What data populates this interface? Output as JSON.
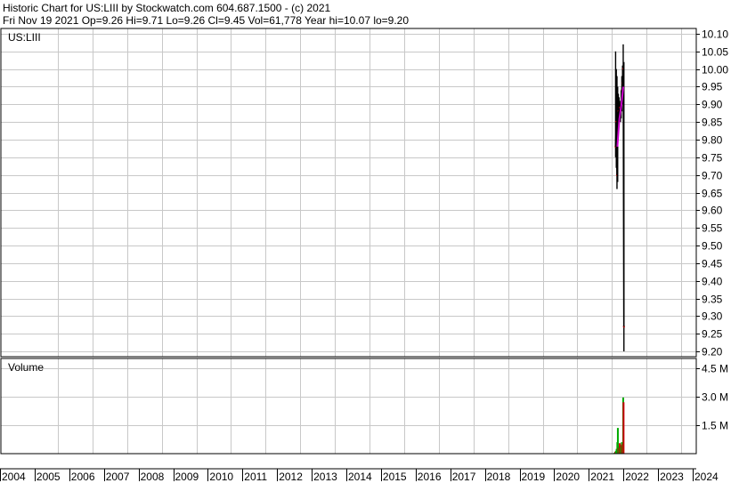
{
  "header": {
    "line1": "Historic Chart for US:LIII by Stockwatch.com 604.687.1500 - (c) 2021",
    "line2": "Fri Nov 19 2021  Op=9.26  Hi=9.71  Lo=9.26  Cl=9.45  Vol=61,778  Year hi=10.07  lo=9.20"
  },
  "price_panel": {
    "symbol_label": "US:LIII"
  },
  "volume_panel": {
    "label": "Volume"
  },
  "colors": {
    "price_line": "#000000",
    "moving_average": "#cc00cc",
    "vol_up": "#00aa00",
    "vol_down": "#cc0000",
    "grid": "#c8c8c8"
  },
  "chart_data": [
    {
      "type": "line",
      "title": "US:LIII",
      "x_axis_labels": [
        "2004",
        "2005",
        "2006",
        "2007",
        "2008",
        "2009",
        "2010",
        "2011",
        "2012",
        "2013",
        "2014",
        "2015",
        "2016",
        "2017",
        "2018",
        "2019",
        "2020",
        "2021",
        "2022",
        "2023",
        "2024"
      ],
      "y_tick_labels": [
        "10.10",
        "10.05",
        "10.00",
        "9.95",
        "9.90",
        "9.85",
        "9.80",
        "9.75",
        "9.70",
        "9.65",
        "9.60",
        "9.55",
        "9.50",
        "9.45",
        "9.40",
        "9.35",
        "9.30",
        "9.25",
        "9.20"
      ],
      "ylim": [
        9.185,
        10.115
      ],
      "grid": true,
      "series": [
        {
          "values": [
            {
              "t": 2021.08,
              "hi": 10.05,
              "lo": 9.75,
              "cl": 9.78
            },
            {
              "t": 2021.1,
              "hi": 10.0,
              "lo": 9.72,
              "cl": 9.85
            },
            {
              "t": 2021.12,
              "hi": 9.98,
              "lo": 9.66,
              "cl": 9.7
            },
            {
              "t": 2021.14,
              "hi": 9.95,
              "lo": 9.68,
              "cl": 9.8
            },
            {
              "t": 2021.16,
              "hi": 9.93,
              "lo": 9.82,
              "cl": 9.88
            },
            {
              "t": 2021.18,
              "hi": 9.92,
              "lo": 9.84,
              "cl": 9.86
            },
            {
              "t": 2021.2,
              "hi": 9.91,
              "lo": 9.86,
              "cl": 9.89
            },
            {
              "t": 2021.22,
              "hi": 9.9,
              "lo": 9.85,
              "cl": 9.87
            },
            {
              "t": 2021.24,
              "hi": 9.94,
              "lo": 9.86,
              "cl": 9.9
            },
            {
              "t": 2021.26,
              "hi": 9.98,
              "lo": 9.88,
              "cl": 9.94
            },
            {
              "t": 2021.28,
              "hi": 10.01,
              "lo": 9.9,
              "cl": 9.96
            },
            {
              "t": 2021.3,
              "hi": 10.07,
              "lo": 9.92,
              "cl": 10.0
            },
            {
              "t": 2021.32,
              "hi": 10.02,
              "lo": 9.2,
              "cl": 9.27
            }
          ]
        },
        {
          "values": [
            {
              "t": 2021.13,
              "v": 9.78
            },
            {
              "t": 2021.16,
              "v": 9.82
            },
            {
              "t": 2021.19,
              "v": 9.86
            },
            {
              "t": 2021.22,
              "v": 9.88
            },
            {
              "t": 2021.25,
              "v": 9.9
            },
            {
              "t": 2021.28,
              "v": 9.93
            },
            {
              "t": 2021.3,
              "v": 9.95
            }
          ]
        }
      ]
    },
    {
      "type": "bar",
      "title": "Volume",
      "y_tick_labels": [
        "4.5 M",
        "3.0 M",
        "1.5 M"
      ],
      "ylim": [
        0,
        5.0
      ],
      "units": "M",
      "series": [
        {
          "values": [
            {
              "t": 2021.05,
              "v": 0.05,
              "up": true
            },
            {
              "t": 2021.07,
              "v": 0.1,
              "up": false
            },
            {
              "t": 2021.09,
              "v": 0.15,
              "up": true
            },
            {
              "t": 2021.11,
              "v": 0.25,
              "up": true
            },
            {
              "t": 2021.13,
              "v": 0.6,
              "up": true
            },
            {
              "t": 2021.145,
              "v": 1.35,
              "up": true
            },
            {
              "t": 2021.16,
              "v": 0.3,
              "up": false
            },
            {
              "t": 2021.18,
              "v": 0.4,
              "up": true
            },
            {
              "t": 2021.2,
              "v": 0.55,
              "up": false
            },
            {
              "t": 2021.22,
              "v": 0.35,
              "up": true
            },
            {
              "t": 2021.24,
              "v": 0.45,
              "up": false
            },
            {
              "t": 2021.26,
              "v": 0.6,
              "up": true
            },
            {
              "t": 2021.28,
              "v": 0.5,
              "up": false
            },
            {
              "t": 2021.3,
              "v": 2.95,
              "up": true
            },
            {
              "t": 2021.31,
              "v": 2.7,
              "up": false
            }
          ]
        }
      ]
    }
  ]
}
